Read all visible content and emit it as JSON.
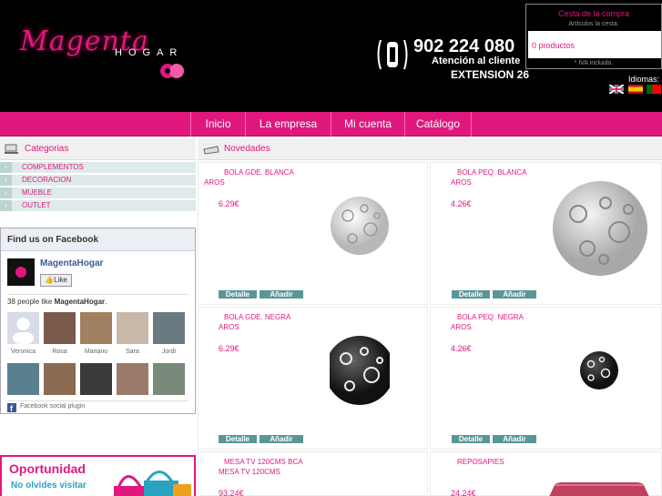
{
  "header": {
    "logo_text": "Magenta",
    "logo_sub": "HOGAR",
    "phone_number": "902 224 080",
    "phone_caption": "Atención al cliente",
    "phone_extension": "EXTENSION 26",
    "cart": {
      "title": "Cesta de la compra",
      "subtitle": "Artículos la cesta:",
      "products": "0 productos",
      "iva": "* IVA incluido."
    },
    "languages_label": "Idiomas:",
    "languages": [
      "English",
      "Español",
      "Português"
    ]
  },
  "nav": {
    "items": [
      "Inicio",
      "La empresa",
      "Mi cuenta",
      "Catálogo"
    ]
  },
  "sidebar": {
    "categories_title": "Categorias",
    "categories": [
      "COMPLEMENTOS",
      "DECORACION",
      "MUEBLE",
      "OUTLET"
    ],
    "facebook": {
      "title": "Find us on Facebook",
      "page_name": "MagentaHogar",
      "like_label": "Like",
      "count_prefix": "38 people like ",
      "count_page": "MagentaHogar",
      "count_suffix": ".",
      "fans": [
        "Veronica",
        "Rosa",
        "Mariano",
        "Sara",
        "Jordi",
        "",
        "",
        "",
        "",
        ""
      ],
      "plugin_label": "Facebook social plugin"
    },
    "promo": {
      "title": "Oportunidad",
      "subtitle": "No olvides visitar"
    }
  },
  "main": {
    "section_title": "Novedades",
    "detail_label": "Detalle",
    "add_label": "Añadir",
    "products": [
      {
        "name": "BOLA GDE. BLANCA",
        "sub": "AROS",
        "price": "6.29€"
      },
      {
        "name": "BOLA PEQ. BLANCA",
        "sub": "AROS",
        "price": "4.26€"
      },
      {
        "name": "BOLA GDE. NEGRA",
        "sub": "AROS",
        "price": "6.29€"
      },
      {
        "name": "BOLA PEQ. NEGRA",
        "sub": "AROS",
        "price": "4.26€"
      },
      {
        "name": "MESA TV 120CMS BCA",
        "sub": "MESA TV 120CMS",
        "price": "93.24€"
      },
      {
        "name": "REPOSAPIES",
        "sub": "",
        "price": "24.24€"
      }
    ]
  },
  "colors": {
    "brand_magenta": "#e0187d",
    "header_bg": "#000000",
    "button_teal": "#5a9696",
    "facebook_blue": "#3b5998"
  }
}
